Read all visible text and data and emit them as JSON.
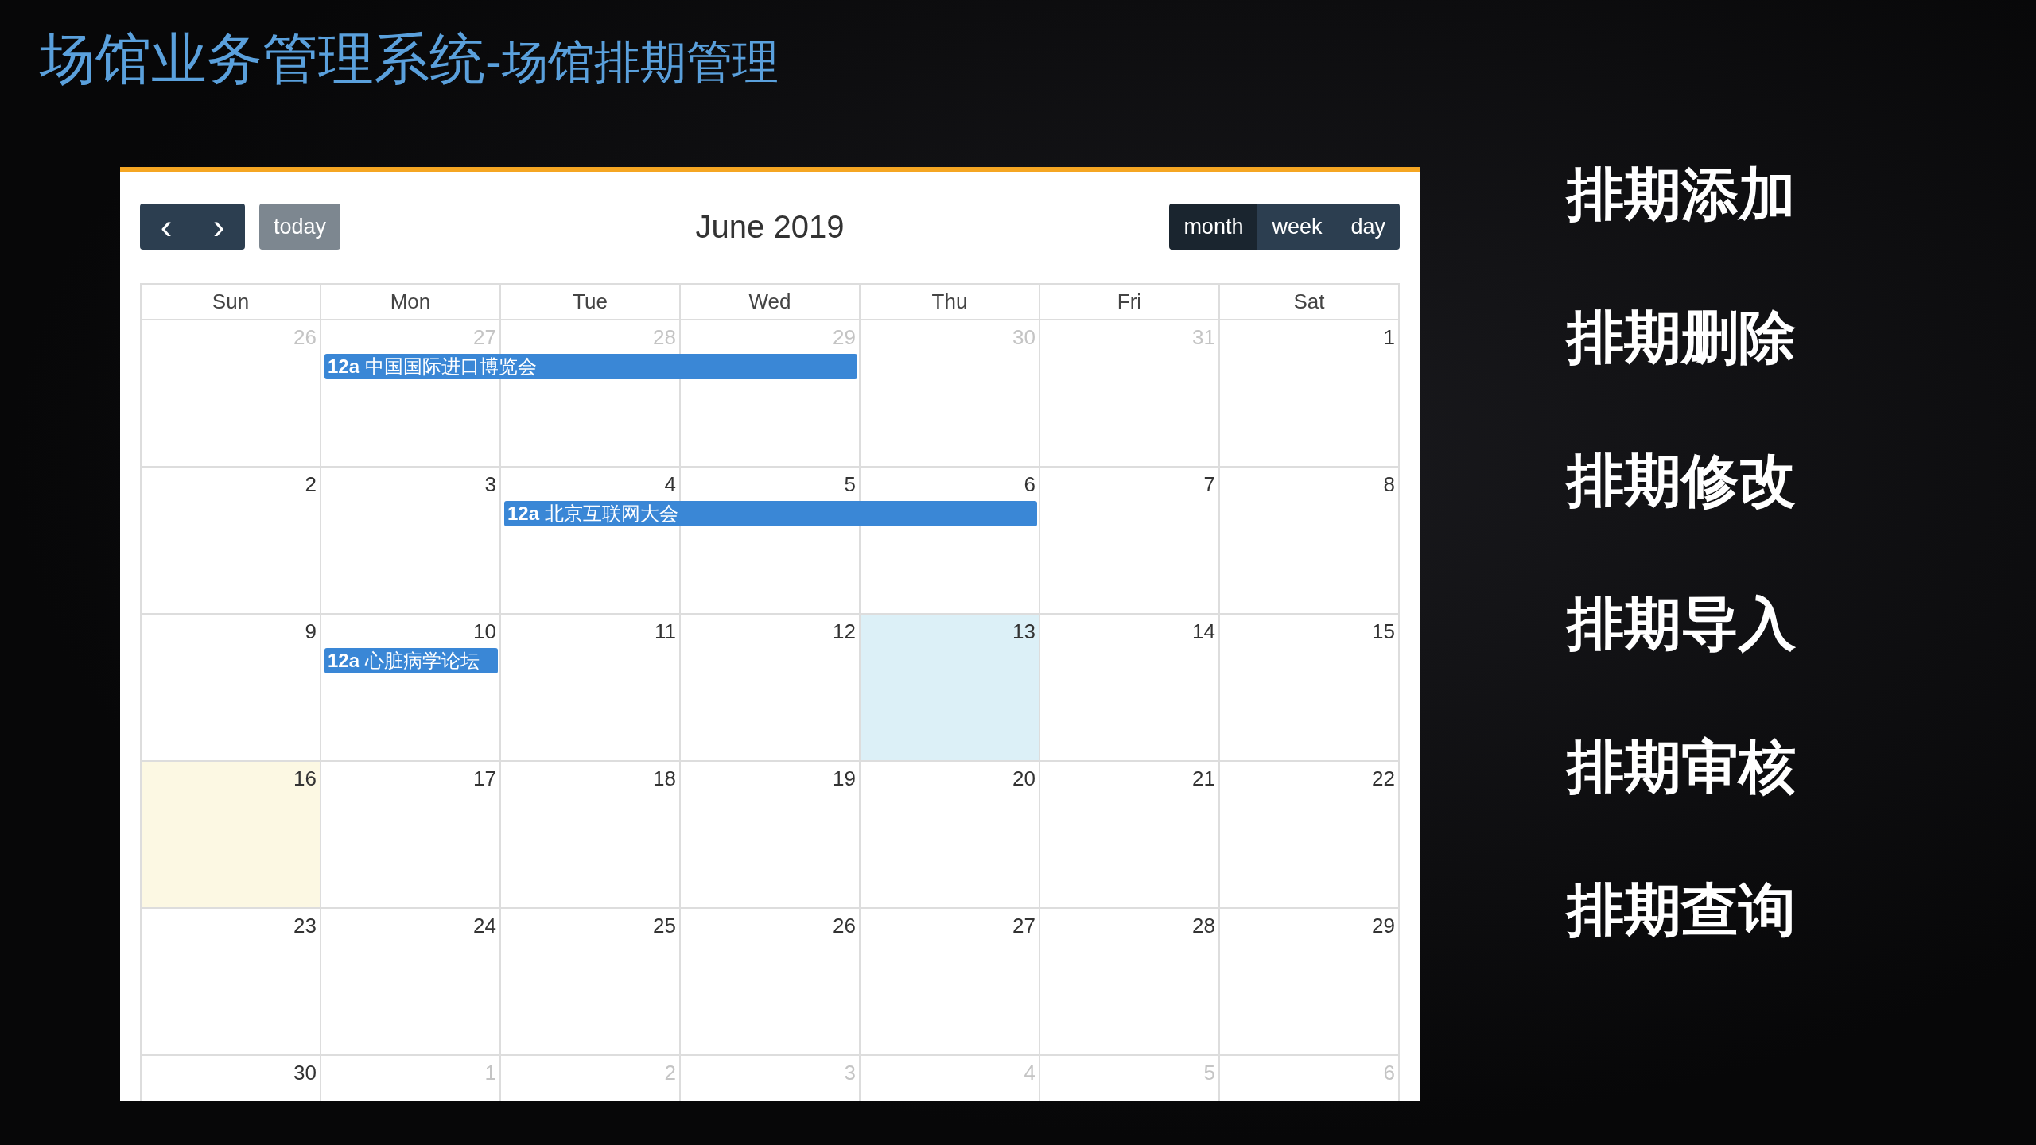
{
  "title": {
    "main": "场馆业务管理系统",
    "sub": "-场馆排期管理"
  },
  "calendar": {
    "nav": {
      "prev": "‹",
      "next": "›",
      "today": "today",
      "today_disabled": true
    },
    "heading": "June 2019",
    "views": [
      {
        "label": "month",
        "selected": true
      },
      {
        "label": "week",
        "selected": false
      },
      {
        "label": "day",
        "selected": false
      }
    ],
    "weekdays": [
      "Sun",
      "Mon",
      "Tue",
      "Wed",
      "Thu",
      "Fri",
      "Sat"
    ],
    "weeks": [
      {
        "days": [
          {
            "date": "26",
            "other_month": true,
            "today": false,
            "selected": false
          },
          {
            "date": "27",
            "other_month": true,
            "today": false,
            "selected": false
          },
          {
            "date": "28",
            "other_month": true,
            "today": false,
            "selected": false
          },
          {
            "date": "29",
            "other_month": true,
            "today": false,
            "selected": false
          },
          {
            "date": "30",
            "other_month": true,
            "today": false,
            "selected": false
          },
          {
            "date": "31",
            "other_month": true,
            "today": false,
            "selected": false
          },
          {
            "date": "1",
            "other_month": false,
            "today": false,
            "selected": false
          }
        ],
        "event_lane": [
          {
            "kind": "empty"
          },
          {
            "kind": "start",
            "time": "12a",
            "title": "中国国际进口博览会"
          },
          {
            "kind": "continue"
          },
          {
            "kind": "continue"
          },
          {
            "kind": "empty"
          },
          {
            "kind": "empty"
          },
          {
            "kind": "empty"
          }
        ]
      },
      {
        "days": [
          {
            "date": "2",
            "other_month": false,
            "today": false,
            "selected": false
          },
          {
            "date": "3",
            "other_month": false,
            "today": false,
            "selected": false
          },
          {
            "date": "4",
            "other_month": false,
            "today": false,
            "selected": false
          },
          {
            "date": "5",
            "other_month": false,
            "today": false,
            "selected": false
          },
          {
            "date": "6",
            "other_month": false,
            "today": false,
            "selected": false
          },
          {
            "date": "7",
            "other_month": false,
            "today": false,
            "selected": false
          },
          {
            "date": "8",
            "other_month": false,
            "today": false,
            "selected": false
          }
        ],
        "event_lane": [
          {
            "kind": "empty"
          },
          {
            "kind": "empty"
          },
          {
            "kind": "start",
            "time": "12a",
            "title": "北京互联网大会"
          },
          {
            "kind": "continue"
          },
          {
            "kind": "continue"
          },
          {
            "kind": "empty"
          },
          {
            "kind": "empty"
          }
        ]
      },
      {
        "days": [
          {
            "date": "9",
            "other_month": false,
            "today": false,
            "selected": false
          },
          {
            "date": "10",
            "other_month": false,
            "today": false,
            "selected": false
          },
          {
            "date": "11",
            "other_month": false,
            "today": false,
            "selected": false
          },
          {
            "date": "12",
            "other_month": false,
            "today": false,
            "selected": false
          },
          {
            "date": "13",
            "other_month": false,
            "today": true,
            "selected": false
          },
          {
            "date": "14",
            "other_month": false,
            "today": false,
            "selected": false
          },
          {
            "date": "15",
            "other_month": false,
            "today": false,
            "selected": false
          }
        ],
        "event_lane": [
          {
            "kind": "empty"
          },
          {
            "kind": "start",
            "time": "12a",
            "title": "心脏病学论坛"
          },
          {
            "kind": "empty"
          },
          {
            "kind": "empty"
          },
          {
            "kind": "empty"
          },
          {
            "kind": "empty"
          },
          {
            "kind": "empty"
          }
        ]
      },
      {
        "days": [
          {
            "date": "16",
            "other_month": false,
            "today": false,
            "selected": true
          },
          {
            "date": "17",
            "other_month": false,
            "today": false,
            "selected": false
          },
          {
            "date": "18",
            "other_month": false,
            "today": false,
            "selected": false
          },
          {
            "date": "19",
            "other_month": false,
            "today": false,
            "selected": false
          },
          {
            "date": "20",
            "other_month": false,
            "today": false,
            "selected": false
          },
          {
            "date": "21",
            "other_month": false,
            "today": false,
            "selected": false
          },
          {
            "date": "22",
            "other_month": false,
            "today": false,
            "selected": false
          }
        ]
      },
      {
        "days": [
          {
            "date": "23",
            "other_month": false,
            "today": false,
            "selected": false
          },
          {
            "date": "24",
            "other_month": false,
            "today": false,
            "selected": false
          },
          {
            "date": "25",
            "other_month": false,
            "today": false,
            "selected": false
          },
          {
            "date": "26",
            "other_month": false,
            "today": false,
            "selected": false
          },
          {
            "date": "27",
            "other_month": false,
            "today": false,
            "selected": false
          },
          {
            "date": "28",
            "other_month": false,
            "today": false,
            "selected": false
          },
          {
            "date": "29",
            "other_month": false,
            "today": false,
            "selected": false
          }
        ]
      },
      {
        "days": [
          {
            "date": "30",
            "other_month": false,
            "today": false,
            "selected": false
          },
          {
            "date": "1",
            "other_month": true,
            "today": false,
            "selected": false
          },
          {
            "date": "2",
            "other_month": true,
            "today": false,
            "selected": false
          },
          {
            "date": "3",
            "other_month": true,
            "today": false,
            "selected": false
          },
          {
            "date": "4",
            "other_month": true,
            "today": false,
            "selected": false
          },
          {
            "date": "5",
            "other_month": true,
            "today": false,
            "selected": false
          },
          {
            "date": "6",
            "other_month": true,
            "today": false,
            "selected": false
          }
        ]
      }
    ]
  },
  "features": [
    "排期添加",
    "排期删除",
    "排期修改",
    "排期导入",
    "排期审核",
    "排期查询"
  ]
}
